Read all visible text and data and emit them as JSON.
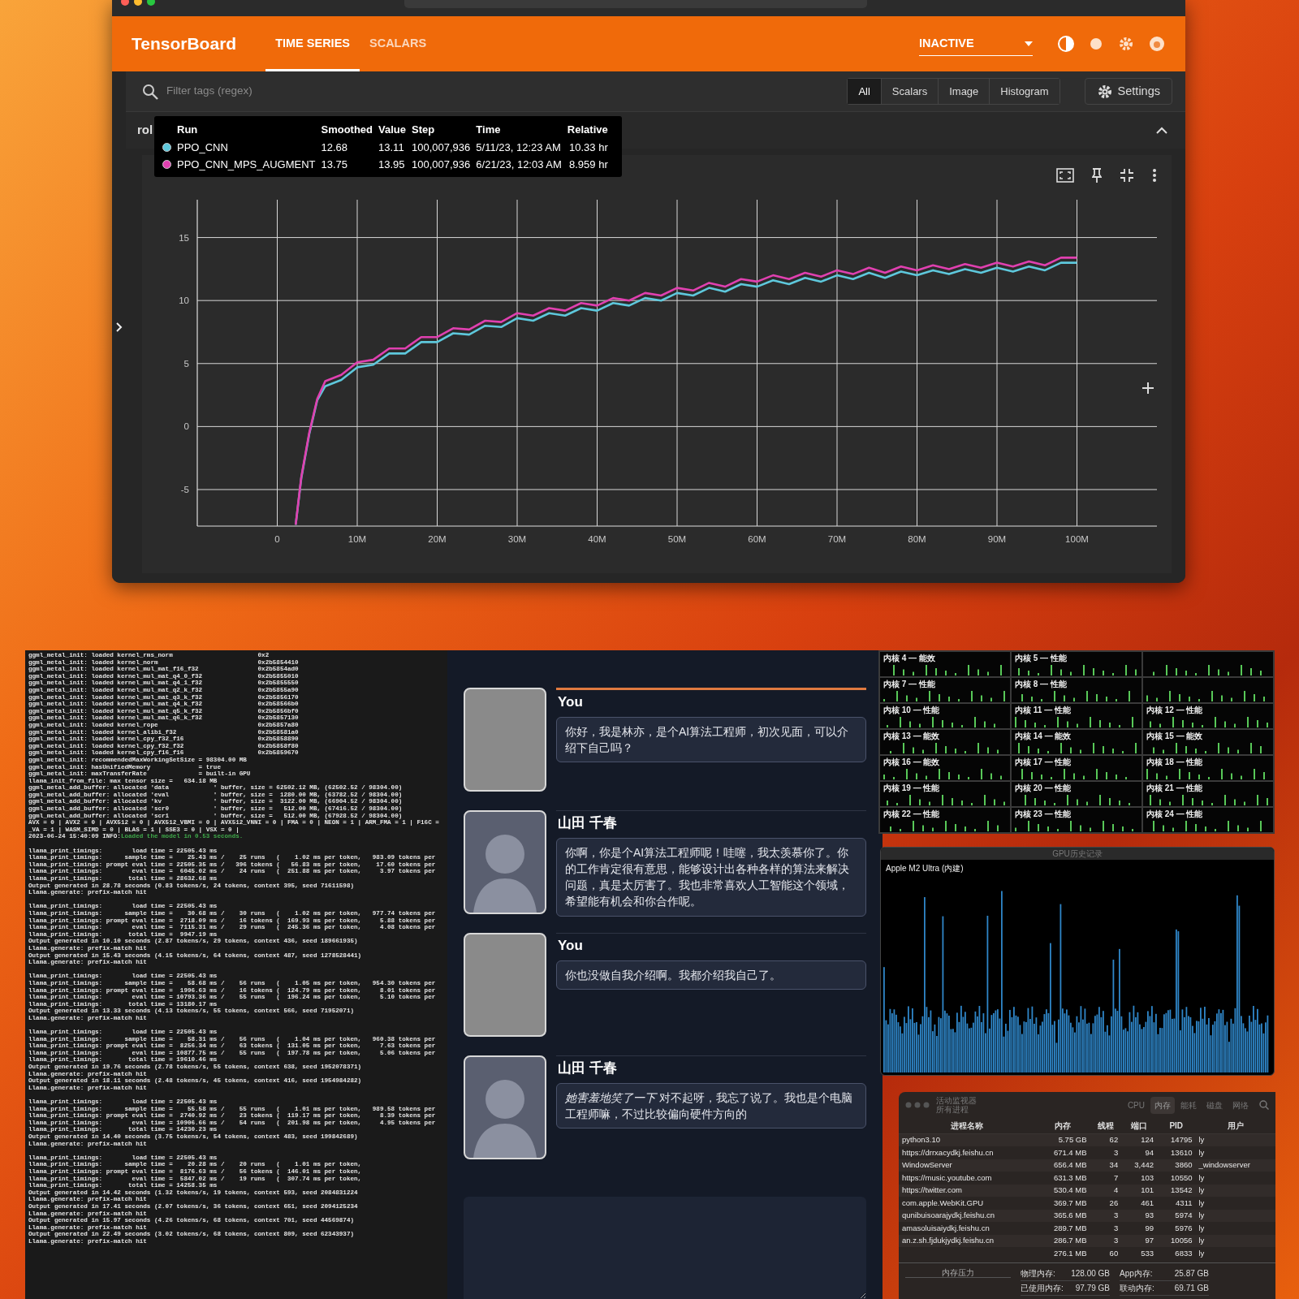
{
  "tensorboard": {
    "title": "TensorBoard",
    "tabs": [
      {
        "label": "TIME SERIES",
        "selected": true
      },
      {
        "label": "SCALARS",
        "selected": false
      }
    ],
    "status_dropdown": "INACTIVE",
    "filter": {
      "placeholder": "Filter tags (regex)"
    },
    "type_filters": [
      {
        "label": "All",
        "selected": true
      },
      {
        "label": "Scalars",
        "selected": false
      },
      {
        "label": "Image",
        "selected": false
      },
      {
        "label": "Histogram",
        "selected": false
      }
    ],
    "settings_button": "Settings",
    "section_title": "rol",
    "tooltip": {
      "columns": [
        "Run",
        "Smoothed",
        "Value",
        "Step",
        "Time",
        "Relative"
      ],
      "rows": [
        {
          "color": "#5ec8dc",
          "cells": [
            "PPO_CNN",
            "12.68",
            "13.11",
            "100,007,936",
            "5/11/23, 12:23 AM",
            "10.33 hr"
          ]
        },
        {
          "color": "#e040b0",
          "cells": [
            "PPO_CNN_MPS_AUGMENT",
            "13.75",
            "13.95",
            "100,007,936",
            "6/21/23, 12:03 AM",
            "8.959 hr"
          ]
        }
      ]
    },
    "chart_data": {
      "type": "line",
      "x": [
        2.3,
        3,
        4,
        5,
        6,
        8,
        10,
        12,
        14,
        16,
        18,
        20,
        22,
        24,
        26,
        28,
        30,
        32,
        34,
        36,
        38,
        40,
        42,
        44,
        46,
        48,
        50,
        52,
        54,
        56,
        58,
        60,
        62,
        64,
        66,
        68,
        70,
        72,
        74,
        76,
        78,
        80,
        82,
        84,
        86,
        88,
        90,
        92,
        94,
        96,
        98,
        100
      ],
      "series": [
        {
          "color": "#5ec8dc",
          "values": [
            -7.8,
            -4.1,
            -0.6,
            2.1,
            3.2,
            3.7,
            4.7,
            4.9,
            5.8,
            5.8,
            6.7,
            6.7,
            7.4,
            7.3,
            8.0,
            7.9,
            8.6,
            8.4,
            9.0,
            8.8,
            9.4,
            9.2,
            9.8,
            9.6,
            10.2,
            10.0,
            10.6,
            10.4,
            11.0,
            10.7,
            11.3,
            11.1,
            11.6,
            11.3,
            11.8,
            11.5,
            12.0,
            11.7,
            12.2,
            11.8,
            12.3,
            12.0,
            12.4,
            12.1,
            12.5,
            12.2,
            12.6,
            12.3,
            12.7,
            12.4,
            13.0,
            13.0
          ]
        },
        {
          "color": "#e040b0",
          "values": [
            -7.8,
            -4,
            -0.5,
            2.2,
            3.6,
            4.1,
            5.1,
            5.3,
            6.2,
            6.2,
            7.1,
            7.1,
            7.8,
            7.7,
            8.4,
            8.3,
            9.0,
            8.8,
            9.4,
            9.2,
            9.8,
            9.6,
            10.2,
            10.0,
            10.6,
            10.4,
            11.0,
            10.8,
            11.4,
            11.1,
            11.7,
            11.5,
            12.0,
            11.7,
            12.2,
            11.9,
            12.4,
            12.1,
            12.6,
            12.2,
            12.7,
            12.4,
            12.8,
            12.5,
            12.9,
            12.6,
            13.0,
            12.7,
            13.1,
            12.8,
            13.4,
            13.4
          ]
        }
      ],
      "grid": true,
      "xlim": [
        -10,
        110
      ],
      "ylim": [
        -7.9,
        18
      ],
      "xticks": [
        {
          "value": 0,
          "label": "0"
        },
        {
          "value": 10,
          "label": "10M"
        },
        {
          "value": 20,
          "label": "20M"
        },
        {
          "value": 30,
          "label": "30M"
        },
        {
          "value": 40,
          "label": "40M"
        },
        {
          "value": 50,
          "label": "50M"
        },
        {
          "value": 60,
          "label": "60M"
        },
        {
          "value": 70,
          "label": "70M"
        },
        {
          "value": 80,
          "label": "80M"
        },
        {
          "value": 90,
          "label": "90M"
        },
        {
          "value": 100,
          "label": "100M"
        }
      ],
      "yticks": [
        -5,
        0,
        5,
        10,
        15
      ]
    }
  },
  "terminal": {
    "blocks": [
      [
        {
          "text": "ggml_metal_init: loaded kernel_rms_norm                       0x2"
        },
        {
          "text": "ggml_metal_init: loaded kernel_norm                           0x2b5854410"
        },
        {
          "text": "ggml_metal_init: loaded kernel_mul_mat_f16_f32                0x2b5854ad0"
        },
        {
          "text": "ggml_metal_init: loaded kernel_mul_mat_q4_0_f32               0x2b5855010"
        },
        {
          "text": "ggml_metal_init: loaded kernel_mul_mat_q4_1_f32               0x2b5855550"
        },
        {
          "text": "ggml_metal_init: loaded kernel_mul_mat_q2_k_f32               0x2b5855a90"
        },
        {
          "text": "ggml_metal_init: loaded kernel_mul_mat_q3_k_f32               0x2b5856170"
        },
        {
          "text": "ggml_metal_init: loaded kernel_mul_mat_q4_k_f32               0x2b58566b0"
        },
        {
          "text": "ggml_metal_init: loaded kernel_mul_mat_q5_k_f32               0x2b5856bf0"
        },
        {
          "text": "ggml_metal_init: loaded kernel_mul_mat_q6_k_f32               0x2b5857130"
        },
        {
          "text": "ggml_metal_init: loaded kernel_rope                           0x2b5857a80"
        },
        {
          "text": "ggml_metal_init: loaded kernel_alibi_f32                      0x2b58581a0"
        },
        {
          "text": "ggml_metal_init: loaded kernel_cpy_f32_f16                    0x2b5858890"
        },
        {
          "text": "ggml_metal_init: loaded kernel_cpy_f32_f32                    0x2b5858f80"
        },
        {
          "text": "ggml_metal_init: loaded kernel_cpy_f16_f16                    0x2b5859670"
        },
        {
          "text": "ggml_metal_init: recommendedMaxWorkingSetSize = 98304.00 MB"
        },
        {
          "text": "ggml_metal_init: hasUnifiedMemory             = true"
        },
        {
          "text": "ggml_metal_init: maxTransferRate              = built-in GPU"
        },
        {
          "text": "llama_init_from_file: max tensor size =   634.18 MB"
        },
        {
          "text": "ggml_metal_add_buffer: allocated 'data            ' buffer, size = 62502.12 MB, (62502.52 / 98304.00)"
        },
        {
          "text": "ggml_metal_add_buffer: allocated 'eval            ' buffer, size =  1280.00 MB, (63782.52 / 98304.00)"
        },
        {
          "text": "ggml_metal_add_buffer: allocated 'kv              ' buffer, size =  3122.00 MB, (66904.52 / 98304.00)"
        },
        {
          "text": "ggml_metal_add_buffer: allocated 'scr0            ' buffer, size =   512.00 MB, (67416.52 / 98304.00)"
        },
        {
          "text": "ggml_metal_add_buffer: allocated 'scr1            ' buffer, size =   512.00 MB, (67928.52 / 98304.00)"
        },
        {
          "text": "AVX = 0 | AVX2 = 0 | AVX512 = 0 | AVX512_VBMI = 0 | AVX512_VNNI = 0 | FMA = 0 | NEON = 1 | ARM_FMA = 1 | F16C ="
        },
        {
          "text": "_VA = 1 | WASM_SIMD = 0 | BLAS = 1 | SSE3 = 0 | VSX = 0 |"
        },
        {
          "text": "2023-06-24 15:40:09 INFO:",
          "highlight": "Loaded the model in 0.53 seconds."
        }
      ],
      [
        {
          "text": "llama_print_timings:        load time = 22505.43 ms"
        },
        {
          "text": "llama_print_timings:      sample time =    25.43 ms /    25 runs   (    1.02 ms per token,   983.09 tokens per"
        },
        {
          "text": "llama_print_timings: prompt eval time = 22505.35 ms /   396 tokens (   56.83 ms per token,    17.60 tokens per"
        },
        {
          "text": "llama_print_timings:        eval time =  6045.02 ms /    24 runs   (  251.88 ms per token,     3.97 tokens per"
        },
        {
          "text": "llama_print_timings:       total time = 28632.68 ms"
        },
        {
          "text": "Output generated in 28.78 seconds (0.83 tokens/s, 24 tokens, context 395, seed 71611598)"
        },
        {
          "text": "Llama.generate: prefix-match hit"
        }
      ],
      [
        {
          "text": "llama_print_timings:        load time = 22505.43 ms"
        },
        {
          "text": "llama_print_timings:      sample time =    30.68 ms /    30 runs   (    1.02 ms per token,   977.74 tokens per"
        },
        {
          "text": "llama_print_timings: prompt eval time =  2718.09 ms /    16 tokens (  169.93 ms per token,     5.88 tokens per"
        },
        {
          "text": "llama_print_timings:        eval time =  7115.31 ms /    29 runs   (  245.36 ms per token,     4.08 tokens per"
        },
        {
          "text": "llama_print_timings:       total time =  9947.19 ms"
        },
        {
          "text": "Output generated in 10.10 seconds (2.87 tokens/s, 29 tokens, context 436, seed 189661935)"
        },
        {
          "text": "Llama.generate: prefix-match hit"
        },
        {
          "text": "Output generated in 15.43 seconds (4.15 tokens/s, 64 tokens, context 487, seed 1278528441)"
        },
        {
          "text": "Llama.generate: prefix-match hit"
        }
      ],
      [
        {
          "text": "llama_print_timings:        load time = 22505.43 ms"
        },
        {
          "text": "llama_print_timings:      sample time =    58.68 ms /    56 runs   (    1.05 ms per token,   954.30 tokens per"
        },
        {
          "text": "llama_print_timings: prompt eval time =  1996.63 ms /    16 tokens (  124.79 ms per token,     8.01 tokens per"
        },
        {
          "text": "llama_print_timings:        eval time = 10793.36 ms /    55 runs   (  196.24 ms per token,     5.10 tokens per"
        },
        {
          "text": "llama_print_timings:       total time = 13180.17 ms"
        },
        {
          "text": "Output generated in 13.33 seconds (4.13 tokens/s, 55 tokens, context 566, seed 71952071)"
        },
        {
          "text": "Llama.generate: prefix-match hit"
        }
      ],
      [
        {
          "text": "llama_print_timings:        load time = 22505.43 ms"
        },
        {
          "text": "llama_print_timings:      sample time =    58.31 ms /    56 runs   (    1.04 ms per token,   960.38 tokens per"
        },
        {
          "text": "llama_print_timings: prompt eval time =  8256.34 ms /    63 tokens (  131.05 ms per token,     7.63 tokens per"
        },
        {
          "text": "llama_print_timings:        eval time = 10877.75 ms /    55 runs   (  197.78 ms per token,     5.06 tokens per"
        },
        {
          "text": "llama_print_timings:       total time = 19610.46 ms"
        },
        {
          "text": "Output generated in 19.76 seconds (2.78 tokens/s, 55 tokens, context 638, seed 1952078371)"
        },
        {
          "text": "Llama.generate: prefix-match hit"
        },
        {
          "text": "Output generated in 18.11 seconds (2.48 tokens/s, 45 tokens, context 416, seed 1954984282)"
        },
        {
          "text": "Llama.generate: prefix-match hit"
        }
      ],
      [
        {
          "text": "llama_print_timings:        load time = 22505.43 ms"
        },
        {
          "text": "llama_print_timings:      sample time =    55.58 ms /    55 runs   (    1.01 ms per token,   989.58 tokens per"
        },
        {
          "text": "llama_print_timings: prompt eval time =  2740.92 ms /    23 tokens (  119.17 ms per token,     8.39 tokens per"
        },
        {
          "text": "llama_print_timings:        eval time = 10906.66 ms /    54 runs   (  201.98 ms per token,     4.95 tokens per"
        },
        {
          "text": "llama_print_timings:       total time = 14230.23 ms"
        },
        {
          "text": "Output generated in 14.40 seconds (3.75 tokens/s, 54 tokens, context 483, seed 199842689)"
        },
        {
          "text": "Llama.generate: prefix-match hit"
        }
      ],
      [
        {
          "text": "llama_print_timings:        load time = 22505.43 ms"
        },
        {
          "text": "llama_print_timings:      sample time =    20.28 ms /    20 runs   (    1.01 ms per token,"
        },
        {
          "text": "llama_print_timings: prompt eval time =  8176.63 ms /    56 tokens (  146.01 ms per token,"
        },
        {
          "text": "llama_print_timings:        eval time =  5847.02 ms /    19 runs   (  307.74 ms per token,"
        },
        {
          "text": "llama_print_timings:       total time = 14258.35 ms"
        },
        {
          "text": "Output generated in 14.42 seconds (1.32 tokens/s, 19 tokens, context 593, seed 2084831224"
        },
        {
          "text": "Llama.generate: prefix-match hit"
        },
        {
          "text": "Output generated in 17.41 seconds (2.07 tokens/s, 36 tokens, context 651, seed 2094125234"
        },
        {
          "text": "Llama.generate: prefix-match hit"
        },
        {
          "text": "Output generated in 15.97 seconds (4.26 tokens/s, 68 tokens, context 701, seed 44569874)"
        },
        {
          "text": "Llama.generate: prefix-match hit"
        },
        {
          "text": "Output generated in 22.49 seconds (3.02 tokens/s, 68 tokens, context 809, seed 62343937)"
        },
        {
          "text": "Llama.generate: prefix-match hit"
        }
      ]
    ]
  },
  "chat": {
    "messages": [
      {
        "kind": "user",
        "speaker": "You",
        "text": "你好，我是林亦，是个AI算法工程师，初次见面，可以介绍下自己吗？"
      },
      {
        "kind": "character",
        "speaker": "山田 千春",
        "text": "你啊，你是个AI算法工程师呢！哇噻，我太羡慕你了。你的工作肯定很有意思，能够设计出各种各样的算法来解决问题，真是太厉害了。我也非常喜欢人工智能这个领域，希望能有机会和你合作呢。"
      },
      {
        "kind": "user",
        "speaker": "You",
        "text": "你也没做自我介绍啊。我都介绍我自己了。"
      },
      {
        "kind": "character",
        "speaker": "山田 千春",
        "text": "*她害羞地笑了一下* 对不起呀，我忘了说了。我也是个电脑工程师嘛，不过比较偏向硬件方向的"
      }
    ]
  },
  "cpu_cores": [
    {
      "kind": "core",
      "label": "内核 4 — 能效"
    },
    {
      "kind": "core",
      "label": "内核 5 — 性能"
    },
    {
      "kind": "blurred"
    },
    {
      "kind": "core",
      "label": "内核 7 — 性能"
    },
    {
      "kind": "core",
      "label": "内核 8 — 性能"
    },
    {
      "kind": "blurred"
    },
    {
      "kind": "core",
      "label": "内核 10 — 性能"
    },
    {
      "kind": "core",
      "label": "内核 11 — 性能"
    },
    {
      "kind": "core",
      "label": "内核 12 — 性能"
    },
    {
      "kind": "core",
      "label": "内核 13 — 能效"
    },
    {
      "kind": "core",
      "label": "内核 14 — 能效"
    },
    {
      "kind": "core",
      "label": "内核 15 — 能效"
    },
    {
      "kind": "core",
      "label": "内核 16 — 能效"
    },
    {
      "kind": "core",
      "label": "内核 17 — 性能"
    },
    {
      "kind": "core",
      "label": "内核 18 — 性能"
    },
    {
      "kind": "core",
      "label": "内核 19 — 性能"
    },
    {
      "kind": "core",
      "label": "内核 20 — 性能"
    },
    {
      "kind": "core",
      "label": "内核 21 — 性能"
    },
    {
      "kind": "core",
      "label": "内核 22 — 性能"
    },
    {
      "kind": "core",
      "label": "内核 23 — 性能"
    },
    {
      "kind": "core",
      "label": "内核 24 — 性能"
    }
  ],
  "gpu_history": {
    "title": "GPU历史记录",
    "label": "Apple M2 Ultra (内建)"
  },
  "activity_monitor": {
    "title": "活动监视器",
    "subtitle": "所有进程",
    "tabs": [
      {
        "label": "CPU",
        "selected": false
      },
      {
        "label": "内存",
        "selected": true
      },
      {
        "label": "能耗",
        "selected": false
      },
      {
        "label": "磁盘",
        "selected": false
      },
      {
        "label": "网络",
        "selected": false
      }
    ],
    "columns": [
      "进程名称",
      "内存",
      "线程",
      "端口",
      "PID",
      "用户"
    ],
    "rows": [
      [
        "python3.10",
        "5.75 GB",
        "62",
        "124",
        "14795",
        "ly"
      ],
      [
        "https://drrxacydkj.feishu.cn",
        "671.4 MB",
        "3",
        "94",
        "13610",
        "ly"
      ],
      [
        "WindowServer",
        "656.4 MB",
        "34",
        "3,442",
        "3860",
        "_windowserver"
      ],
      [
        "https://music.youtube.com",
        "631.3 MB",
        "7",
        "103",
        "10550",
        "ly"
      ],
      [
        "https://twitter.com",
        "530.4 MB",
        "4",
        "101",
        "13542",
        "ly"
      ],
      [
        "com.apple.WebKit.GPU",
        "369.7 MB",
        "26",
        "461",
        "4311",
        "ly"
      ],
      [
        "qunibuisoarajydkj.feishu.cn",
        "365.6 MB",
        "3",
        "93",
        "5974",
        "ly"
      ],
      [
        "amasoluisaiydkj.feishu.cn",
        "289.7 MB",
        "3",
        "99",
        "5976",
        "ly"
      ],
      [
        "an.z.sh.fjdukjydkj.feishu.cn",
        "286.7 MB",
        "3",
        "97",
        "10056",
        "ly"
      ],
      [
        null,
        "276.1 MB",
        "60",
        "533",
        "6833",
        "ly"
      ]
    ],
    "memory_pressure_label": "内存压力",
    "memory_stats": [
      {
        "label": "物理内存:",
        "value": "128.00 GB"
      },
      {
        "label": "已使用内存:",
        "value": "97.79 GB"
      }
    ],
    "app_stats": [
      {
        "label": "App内存:",
        "value": "25.87 GB"
      },
      {
        "label": "联动内存:",
        "value": "69.71 GB"
      }
    ]
  }
}
